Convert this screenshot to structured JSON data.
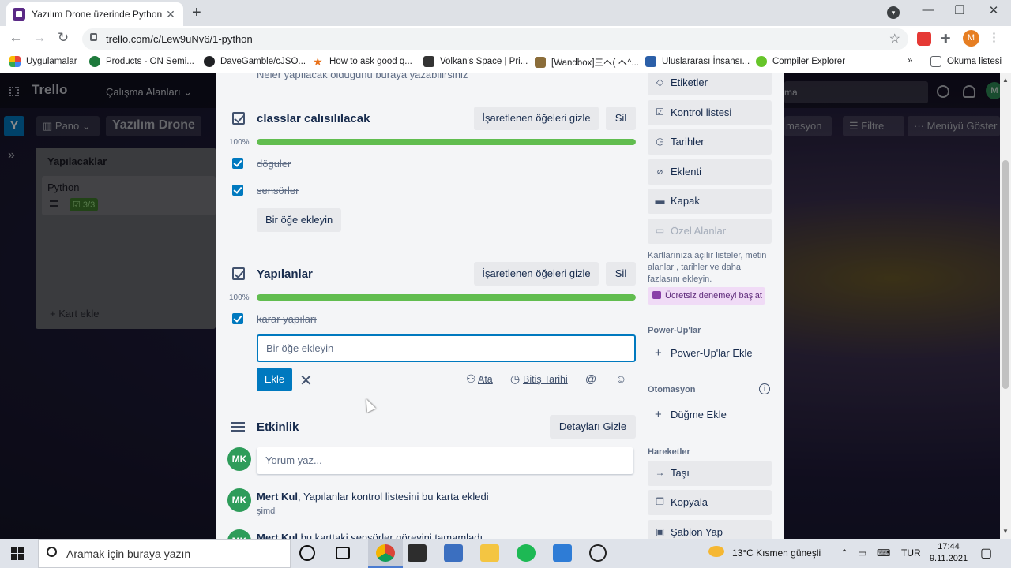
{
  "browser": {
    "tab_title": "Yazılım Drone üzerinde Python | T",
    "url": "trello.com/c/Lew9uNv6/1-python",
    "profile_initial": "M",
    "bookmarks": [
      {
        "label": "Uygulamalar",
        "icon": "apps-grid-icon",
        "color": "#e8453c"
      },
      {
        "label": "Products - ON Semi...",
        "icon": "on-semi-icon",
        "color": "#1e7a3c"
      },
      {
        "label": "DaveGamble/cJSO...",
        "icon": "github-icon",
        "color": "#202124"
      },
      {
        "label": "How to ask good q...",
        "icon": "star-bookmark-icon",
        "color": "#e8711a"
      },
      {
        "label": "Volkan's Space | Pri...",
        "icon": "volkan-icon",
        "color": "#333333"
      },
      {
        "label": "[Wandbox]三へ( へ^...",
        "icon": "wandbox-icon",
        "color": "#8b6d3a"
      },
      {
        "label": "Uluslararası İnsansı...",
        "icon": "robot-icon",
        "color": "#2b5fa8"
      },
      {
        "label": "Compiler Explorer",
        "icon": "compiler-explorer-icon",
        "color": "#67c52a"
      }
    ],
    "reading_list": "Okuma listesi"
  },
  "trello": {
    "logo": "Trello",
    "workspaces": "Çalışma Alanları",
    "search_partial": "ma",
    "workspace_badge": "Y",
    "board_view": "Pano",
    "board_title": "Yazılım Drone",
    "automation_partial": "masyon",
    "filter": "Filtre",
    "menu": "Menüyü Göster",
    "header_avatar": "M",
    "list_title": "Yapılacaklar",
    "card_title": "Python",
    "card_badge": "3/3",
    "add_card": "+ Kart ekle"
  },
  "modal": {
    "description_hint": "Neler yapılacak olduğunu buraya yazabilirsiniz",
    "checklists": [
      {
        "title": "classlar calısılılacak",
        "hide_label": "İşaretlenen öğeleri gizle",
        "delete_label": "Sil",
        "progress_text": "100%",
        "progress": 1.0,
        "items": [
          "döguler",
          "sensörler"
        ],
        "add_item": "Bir öğe ekleyin"
      },
      {
        "title": "Yapılanlar",
        "hide_label": "İşaretlenen öğeleri gizle",
        "delete_label": "Sil",
        "progress_text": "100%",
        "progress": 1.0,
        "items": [
          "karar yapıları"
        ],
        "add_item": "Bir öğe ekleyin"
      }
    ],
    "add_form": {
      "placeholder": "Bir öğe ekleyin",
      "submit": "Ekle",
      "assign": "Ata",
      "due_date": "Bitiş Tarihi"
    },
    "activity": {
      "title": "Etkinlik",
      "hide_details": "Detayları Gizle",
      "comment_placeholder": "Yorum yaz...",
      "avatar": "MK",
      "entries": [
        {
          "user": "Mert Kul",
          "text": ", Yapılanlar kontrol listesini bu karta ekledi",
          "time": "şimdi"
        },
        {
          "user": "Mert Kul",
          "text": " bu karttaki sensörler görevini tamamladı",
          "time": ""
        }
      ]
    },
    "sidebar": {
      "add_to_card": [
        {
          "label": "Etiketler",
          "icon": "tag-icon"
        },
        {
          "label": "Kontrol listesi",
          "icon": "checklist-icon"
        },
        {
          "label": "Tarihler",
          "icon": "clock-icon"
        },
        {
          "label": "Eklenti",
          "icon": "paperclip-icon"
        },
        {
          "label": "Kapak",
          "icon": "cover-icon"
        },
        {
          "label": "Özel Alanlar",
          "icon": "custom-fields-icon"
        }
      ],
      "custom_fields_note": "Kartlarınıza açılır listeler, metin alanları, tarihler ve daha fazlasını ekleyin.",
      "trial": "Ücretsiz denemeyi başlat",
      "powerups_header": "Power-Up'lar",
      "add_powerups": "Power-Up'lar Ekle",
      "automation_header": "Otomasyon",
      "add_button": "Düğme Ekle",
      "actions_header": "Hareketler",
      "actions": [
        {
          "label": "Taşı",
          "icon": "arrow-right-icon"
        },
        {
          "label": "Kopyala",
          "icon": "copy-icon"
        },
        {
          "label": "Şablon Yap",
          "icon": "template-icon"
        }
      ]
    }
  },
  "taskbar": {
    "search_placeholder": "Aramak için buraya yazın",
    "weather": "13°C  Kısmen güneşli",
    "language": "TUR",
    "time": "17:44",
    "date": "9.11.2021"
  },
  "colors": {
    "trello_blue": "#0079bf",
    "progress_green": "#61bd4f",
    "avatar_green": "#2e9c5a"
  }
}
